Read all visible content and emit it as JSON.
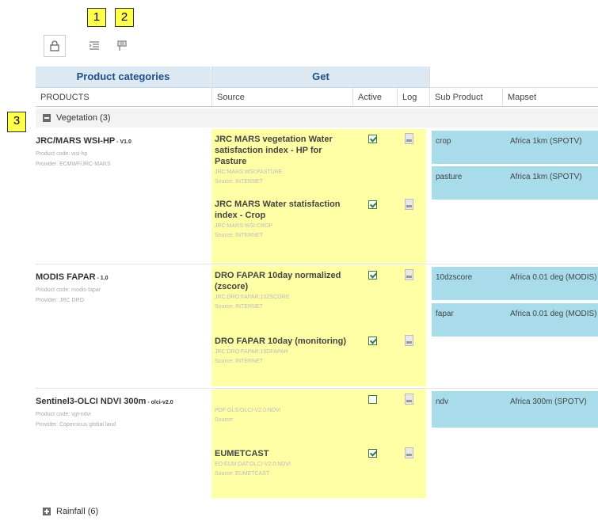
{
  "markers": [
    "1",
    "2",
    "3"
  ],
  "toolbar": {
    "icons": [
      "lock-icon",
      "indent-icon",
      "flag-icon"
    ]
  },
  "header": {
    "group_product_categories": "Product categories",
    "group_get": "Get",
    "col_products": "PRODUCTS",
    "col_source": "Source",
    "col_active": "Active",
    "col_log": "Log",
    "col_sub_product": "Sub Product",
    "col_mapset": "Mapset"
  },
  "groups": [
    {
      "label": "Vegetation (3)",
      "expanded": true
    },
    {
      "label": "Rainfall (6)",
      "expanded": false
    }
  ],
  "products": [
    {
      "name": "JRC/MARS WSI-HP",
      "version": " - V1.0",
      "code": "Product code: wsi-hp",
      "provider": "Provider: ECMWF/JRC-MARS",
      "sources": [
        {
          "title": "JRC MARS vegetation Water satisfaction index - HP for Pasture",
          "code": "JRC:MARS:WSI:PASTURE",
          "source": "Source: INTERNET",
          "active": true
        },
        {
          "title": "JRC MARS Water statisfaction index - Crop",
          "code": "JRC:MARS:WSI:CROP",
          "source": "Source: INTERNET",
          "active": true
        }
      ],
      "subproducts": [
        {
          "name": "crop",
          "mapset": "Africa 1km (SPOTV)"
        },
        {
          "name": "pasture",
          "mapset": "Africa 1km (SPOTV)"
        }
      ]
    },
    {
      "name": "MODIS FAPAR",
      "version": " - 1.0",
      "code": "Product code: modis-fapar",
      "provider": "Provider: JRC DRO",
      "sources": [
        {
          "title": "DRO FAPAR 10day normalized (zscore)",
          "code": "JRC:DRO:FAPAR:10ZSCORE",
          "source": "Source: INTERNET",
          "active": true
        },
        {
          "title": "DRO FAPAR 10day (monitoring)",
          "code": "JRC:DRO:FAPAR:10DFAPAR",
          "source": "Source: INTERNET",
          "active": true
        }
      ],
      "subproducts": [
        {
          "name": "10dzscore",
          "mapset": "Africa 0.01 deg (MODIS)"
        },
        {
          "name": "fapar",
          "mapset": "Africa 0.01 deg (MODIS)"
        }
      ]
    },
    {
      "name": "Sentinel3-OLCI NDVI 300m",
      "version": " - olci-v2.0",
      "code": "Product code: vgt-ndvi",
      "provider": "Provider: Copernicus global land",
      "sources": [
        {
          "title": "",
          "code": "PDF:GLS:OLCI-V2.0:NDVI",
          "source": "Source:",
          "active": false
        },
        {
          "title": "EUMETCAST",
          "code": "EO:EUM:DAT:OLCI-V2.0:NDVI",
          "source": "Source: EUMETCAST",
          "active": true
        }
      ],
      "subproducts": [
        {
          "name": "ndv",
          "mapset": "Africa 300m (SPOTV)"
        }
      ]
    }
  ]
}
